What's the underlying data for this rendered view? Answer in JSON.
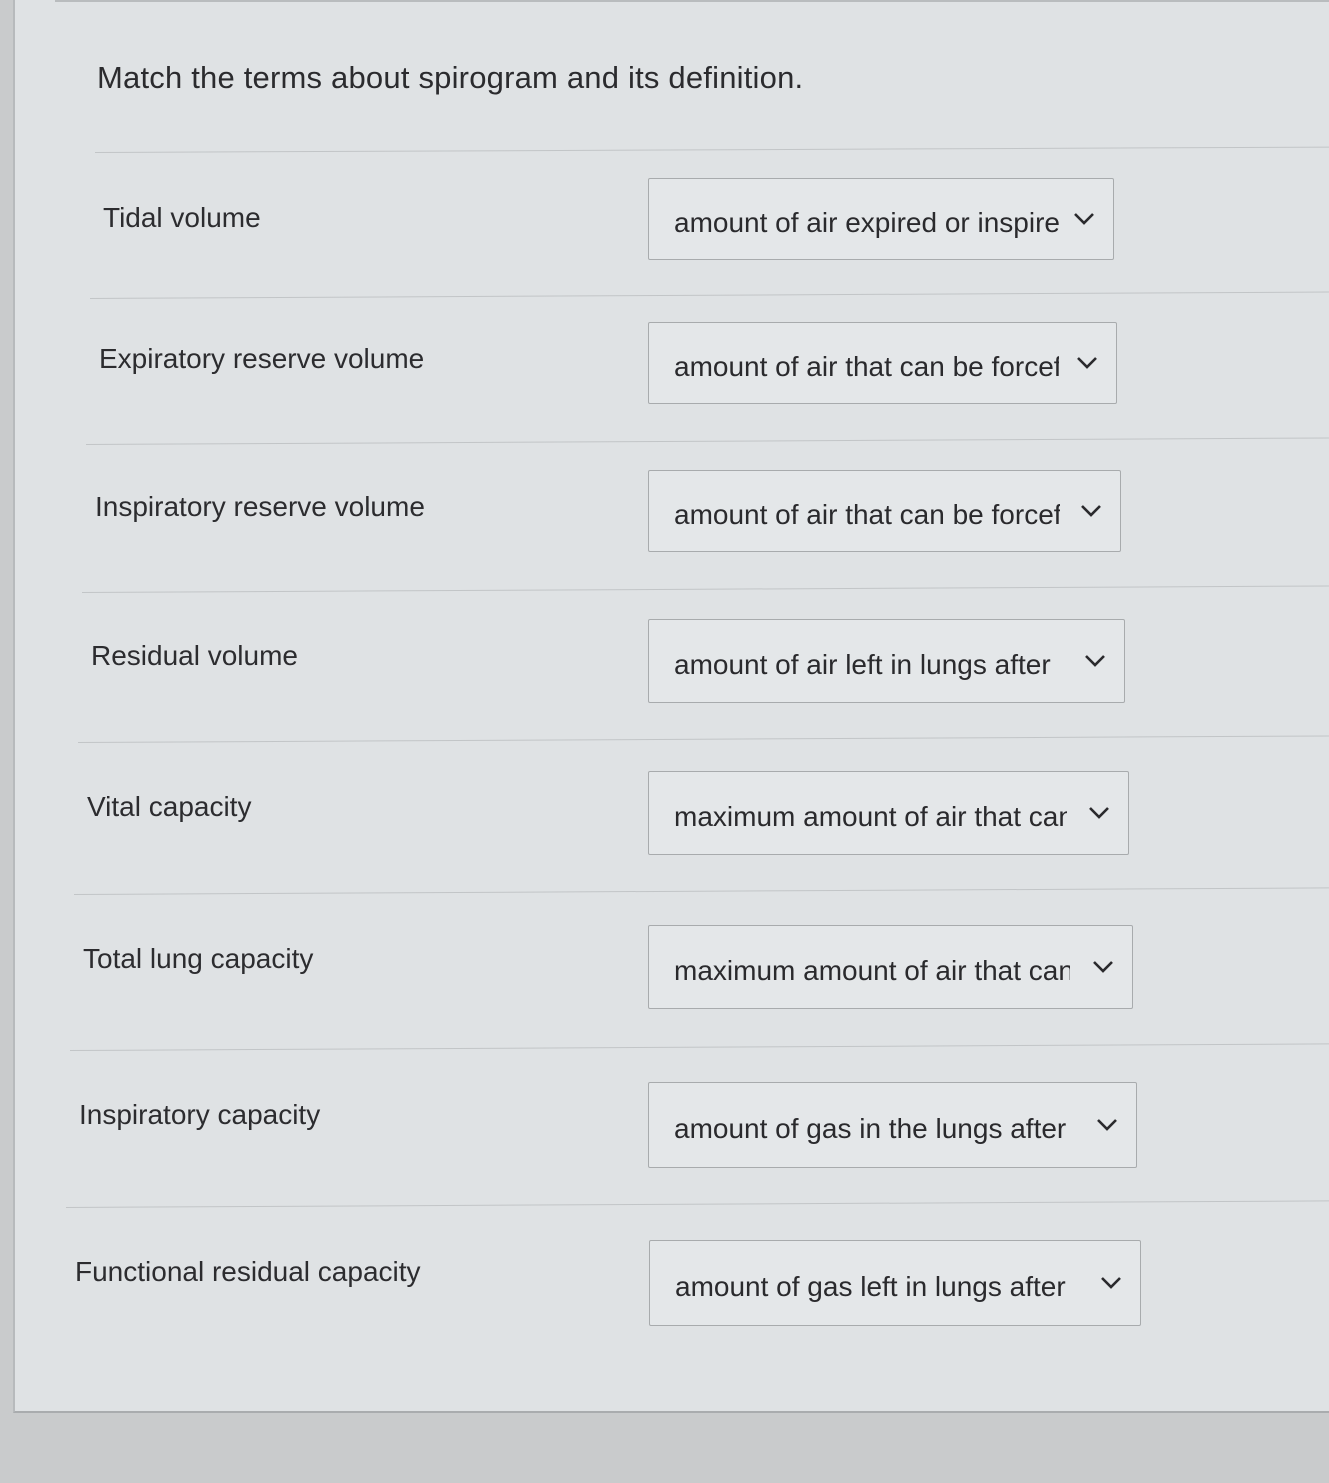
{
  "question": {
    "prompt": "Match the terms about spirogram and its definition."
  },
  "rows": [
    {
      "term": "Tidal volume",
      "selected": "amount of air expired or inspired"
    },
    {
      "term": "Expiratory reserve volume",
      "selected": "amount of air that can be forcefully expired"
    },
    {
      "term": "Inspiratory reserve volume",
      "selected": "amount of air that can be forcefully inspired"
    },
    {
      "term": "Residual volume",
      "selected": "amount of air left in lungs after"
    },
    {
      "term": "Vital capacity",
      "selected": "maximum amount of air that can be"
    },
    {
      "term": "Total lung capacity",
      "selected": "maximum amount of air that can be"
    },
    {
      "term": "Inspiratory capacity",
      "selected": "amount of gas in the lungs after"
    },
    {
      "term": "Functional residual capacity",
      "selected": "amount of gas left in lungs after"
    }
  ],
  "icons": {
    "dropdown": "chevron-down-icon"
  }
}
